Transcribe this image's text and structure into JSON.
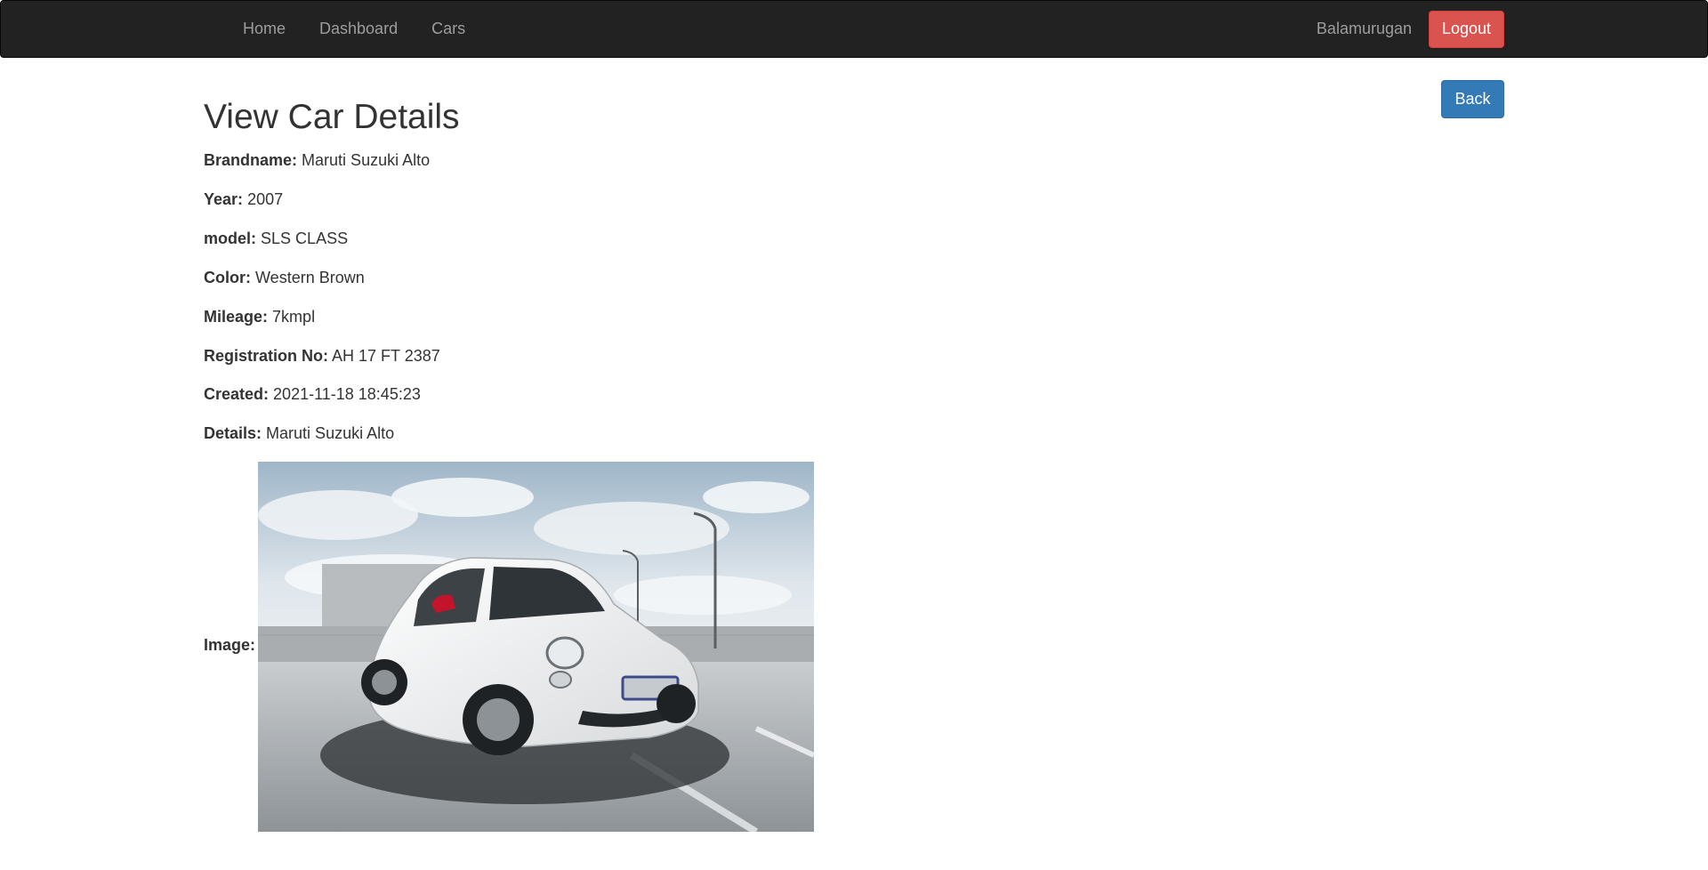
{
  "navbar": {
    "links": [
      "Home",
      "Dashboard",
      "Cars"
    ],
    "user": "Balamurugan",
    "logout_label": "Logout"
  },
  "page": {
    "title": "View Car Details",
    "back_label": "Back"
  },
  "details": [
    {
      "label": "Brandname:",
      "value": "Maruti Suzuki Alto"
    },
    {
      "label": "Year:",
      "value": "2007"
    },
    {
      "label": "model:",
      "value": "SLS CLASS"
    },
    {
      "label": "Color:",
      "value": "Western Brown"
    },
    {
      "label": "Mileage:",
      "value": "7kmpl"
    },
    {
      "label": "Registration No:",
      "value": "AH 17 FT 2387"
    },
    {
      "label": "Created:",
      "value": "2021-11-18 18:45:23"
    },
    {
      "label": "Details:",
      "value": "Maruti Suzuki Alto"
    }
  ],
  "image": {
    "label": "Image:"
  },
  "colors": {
    "navbar_bg": "#222222",
    "logout": "#d9534f",
    "back": "#337ab7"
  }
}
